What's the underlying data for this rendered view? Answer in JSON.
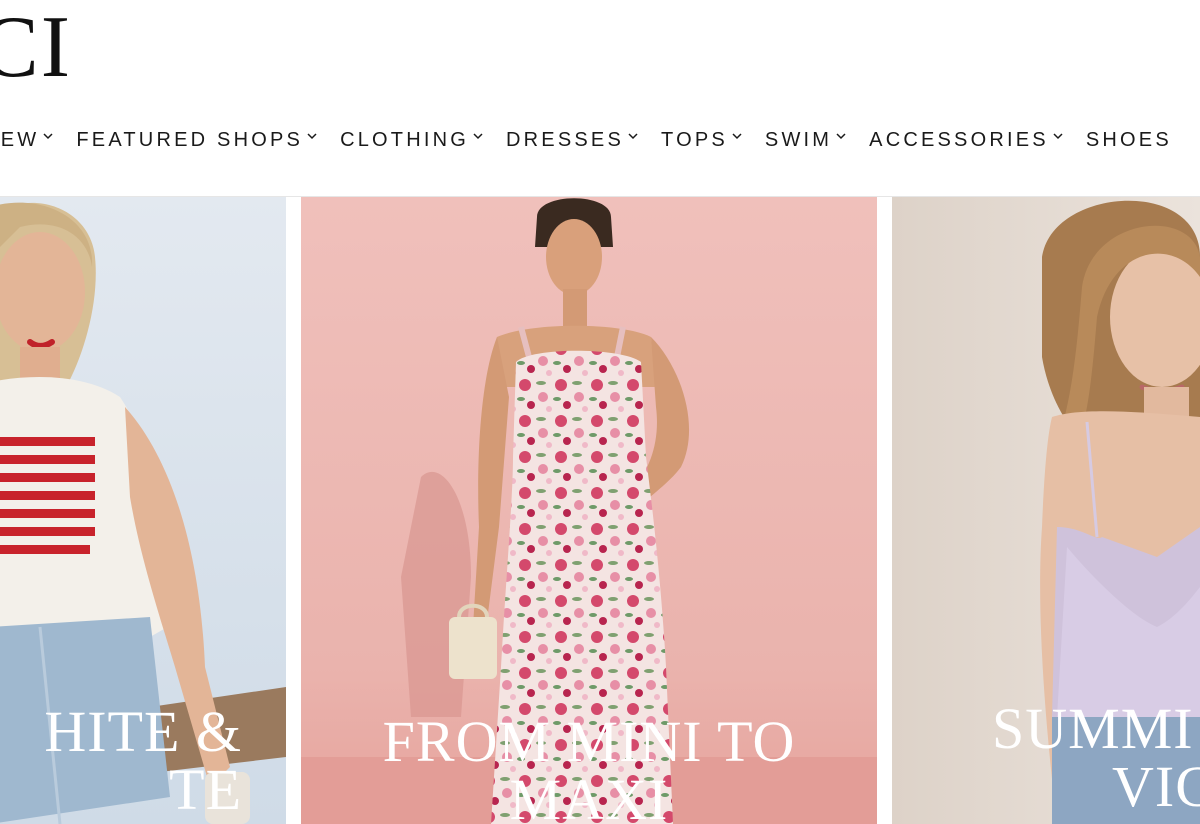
{
  "header": {
    "logo_text": "CI"
  },
  "nav": {
    "items": [
      {
        "label": "NEW",
        "visible_label": "IEW"
      },
      {
        "label": "FEATURED SHOPS"
      },
      {
        "label": "CLOTHING"
      },
      {
        "label": "DRESSES"
      },
      {
        "label": "TOPS"
      },
      {
        "label": "SWIM"
      },
      {
        "label": "ACCESSORIES"
      },
      {
        "label": "SHOES"
      }
    ],
    "chevron_icon": "chevron-down-icon"
  },
  "tiles": [
    {
      "line1": "HITE &",
      "line2": "TE"
    },
    {
      "line1": "FROM MINI TO",
      "line2": "MAXI"
    },
    {
      "line1": "SUMMI",
      "line2": "VIC"
    }
  ],
  "colors": {
    "tile1_bg": "#dfe6ee",
    "tile2_bg": "#eebcb8",
    "tile3_bg": "#e6ddd6",
    "text": "#1a1a1a"
  }
}
